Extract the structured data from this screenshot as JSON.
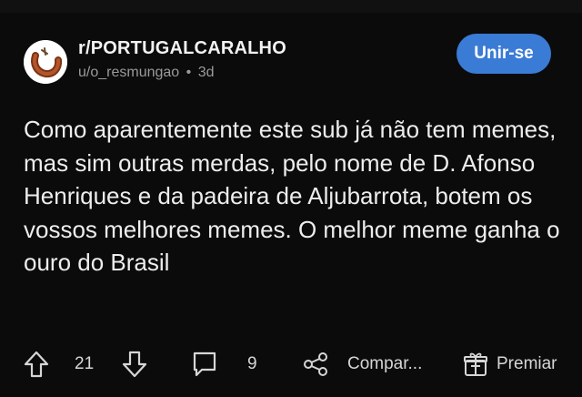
{
  "post": {
    "subreddit": "r/PORTUGALCARALHO",
    "author": "u/o_resmungao",
    "separator": "•",
    "age": "3d",
    "join_label": "Unir-se",
    "body": "Como aparentemente este sub já não tem memes, mas sim outras merdas, pelo nome de D. Afonso Henriques e da padeira de Aljubarrota, botem os vossos melhores memes. O melhor meme ganha o ouro do Brasil"
  },
  "actions": {
    "upvotes": "21",
    "comments": "9",
    "share_label": "Compar...",
    "award_label": "Premiar"
  },
  "colors": {
    "background": "#0b0b0b",
    "join_button": "#3a7bd5",
    "meta_text": "#9a9a9a"
  },
  "icons": [
    "upvote-icon",
    "downvote-icon",
    "comment-icon",
    "share-icon",
    "award-icon"
  ]
}
